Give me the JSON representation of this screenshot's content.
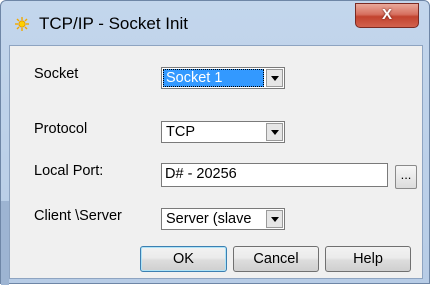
{
  "window": {
    "title": "TCP/IP - Socket Init",
    "close_label": "X"
  },
  "form": {
    "socket_label": "Socket",
    "socket_value": "Socket 1",
    "protocol_label": "Protocol",
    "protocol_value": "TCP",
    "local_port_label": "Local Port:",
    "local_port_value": "D# - 20256",
    "browse_label": "...",
    "client_server_label": "Client \\Server",
    "client_server_value": "Server (slave"
  },
  "buttons": {
    "ok": "OK",
    "cancel": "Cancel",
    "help": "Help"
  },
  "icons": {
    "app": "sun-icon",
    "dropdown": "chevron-down-icon"
  },
  "colors": {
    "selection": "#3399ff",
    "close_button": "#c2432f"
  }
}
